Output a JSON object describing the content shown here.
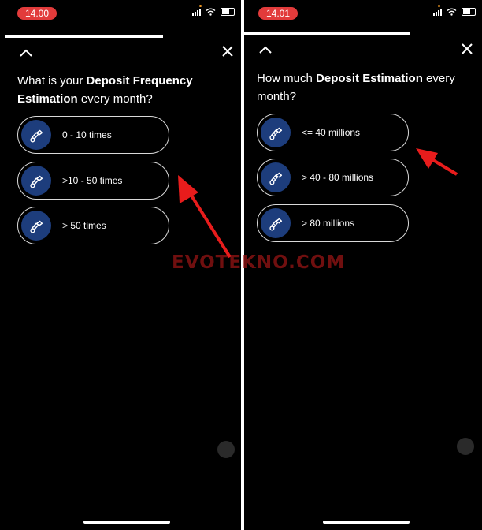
{
  "left": {
    "status_time": "14.00",
    "question_prefix": "What is your ",
    "question_bold": "Deposit Frequency Estimation",
    "question_suffix": " every month?",
    "options": [
      {
        "label": "0 - 10 times",
        "icon": "hand-coin-icon"
      },
      {
        "label": ">10 - 50 times",
        "icon": "hand-coin-icon"
      },
      {
        "label": "> 50 times",
        "icon": "hand-coin-icon"
      }
    ]
  },
  "right": {
    "status_time": "14.01",
    "question_prefix": "How much ",
    "question_bold": "Deposit Estimation",
    "question_suffix": " every month?",
    "options": [
      {
        "label": "<= 40 millions",
        "icon": "hand-coin-icon"
      },
      {
        "label": "> 40 - 80 millions",
        "icon": "hand-coin-icon"
      },
      {
        "label": "> 80 millions",
        "icon": "hand-coin-icon"
      }
    ]
  },
  "watermark": "EVOTEKNO.COM",
  "colors": {
    "accent": "#1d3d7c",
    "time_pill": "#e23b3b",
    "arrow": "#e81c1c"
  }
}
